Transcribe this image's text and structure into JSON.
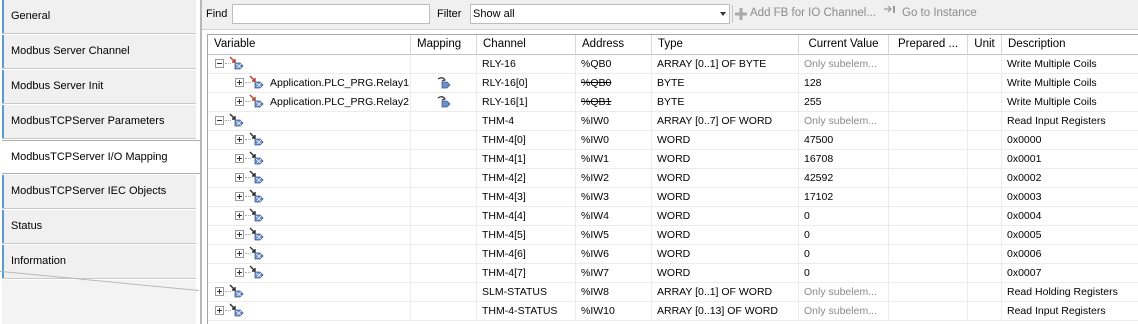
{
  "sidebar": {
    "tabs": [
      {
        "label": "General",
        "active": false
      },
      {
        "label": "Modbus Server Channel",
        "active": false
      },
      {
        "label": "Modbus Server Init",
        "active": false
      },
      {
        "label": "ModbusTCPServer Parameters",
        "active": false
      },
      {
        "label": "ModbusTCPServer I/O Mapping",
        "active": true
      },
      {
        "label": "ModbusTCPServer IEC Objects",
        "active": false
      },
      {
        "label": "Status",
        "active": false
      },
      {
        "label": "Information",
        "active": false
      }
    ]
  },
  "toolbar": {
    "find_label": "Find",
    "find_value": "",
    "filter_label": "Filter",
    "filter_value": "Show all",
    "add_fb_label": "Add FB for IO Channel...",
    "goto_label": "Go to Instance"
  },
  "table": {
    "columns": [
      "Variable",
      "Mapping",
      "Channel",
      "Address",
      "Type",
      "Current Value",
      "Prepared ...",
      "Unit",
      "Description"
    ],
    "rows": [
      {
        "level": 0,
        "expander": "minus",
        "variable": "",
        "mapping": false,
        "channel": "RLY-16",
        "address": "%QB0",
        "address_strike": false,
        "type": "ARRAY [0..1] OF BYTE",
        "current_value": "Only subelem...",
        "value_gray": true,
        "description": "Write Multiple Coils",
        "icon": "output"
      },
      {
        "level": 1,
        "expander": "plus",
        "variable": "Application.PLC_PRG.Relay1",
        "mapping": true,
        "channel": "RLY-16[0]",
        "address": "%QB0",
        "address_strike": true,
        "type": "BYTE",
        "current_value": "128",
        "value_gray": false,
        "description": "Write Multiple Coils",
        "icon": "output"
      },
      {
        "level": 1,
        "expander": "plus",
        "variable": "Application.PLC_PRG.Relay2",
        "mapping": true,
        "channel": "RLY-16[1]",
        "address": "%QB1",
        "address_strike": true,
        "type": "BYTE",
        "current_value": "255",
        "value_gray": false,
        "description": "Write Multiple Coils",
        "icon": "output"
      },
      {
        "level": 0,
        "expander": "minus",
        "variable": "",
        "mapping": false,
        "channel": "THM-4",
        "address": "%IW0",
        "address_strike": false,
        "type": "ARRAY [0..7] OF WORD",
        "current_value": "Only subelem...",
        "value_gray": true,
        "description": "Read Input Registers",
        "icon": "input"
      },
      {
        "level": 1,
        "expander": "plus",
        "variable": "",
        "mapping": false,
        "channel": "THM-4[0]",
        "address": "%IW0",
        "address_strike": false,
        "type": "WORD",
        "current_value": "47500",
        "value_gray": false,
        "description": "0x0000",
        "icon": "input"
      },
      {
        "level": 1,
        "expander": "plus",
        "variable": "",
        "mapping": false,
        "channel": "THM-4[1]",
        "address": "%IW1",
        "address_strike": false,
        "type": "WORD",
        "current_value": "16708",
        "value_gray": false,
        "description": "0x0001",
        "icon": "input"
      },
      {
        "level": 1,
        "expander": "plus",
        "variable": "",
        "mapping": false,
        "channel": "THM-4[2]",
        "address": "%IW2",
        "address_strike": false,
        "type": "WORD",
        "current_value": "42592",
        "value_gray": false,
        "description": "0x0002",
        "icon": "input"
      },
      {
        "level": 1,
        "expander": "plus",
        "variable": "",
        "mapping": false,
        "channel": "THM-4[3]",
        "address": "%IW3",
        "address_strike": false,
        "type": "WORD",
        "current_value": "17102",
        "value_gray": false,
        "description": "0x0003",
        "icon": "input"
      },
      {
        "level": 1,
        "expander": "plus",
        "variable": "",
        "mapping": false,
        "channel": "THM-4[4]",
        "address": "%IW4",
        "address_strike": false,
        "type": "WORD",
        "current_value": "0",
        "value_gray": false,
        "description": "0x0004",
        "icon": "input"
      },
      {
        "level": 1,
        "expander": "plus",
        "variable": "",
        "mapping": false,
        "channel": "THM-4[5]",
        "address": "%IW5",
        "address_strike": false,
        "type": "WORD",
        "current_value": "0",
        "value_gray": false,
        "description": "0x0005",
        "icon": "input"
      },
      {
        "level": 1,
        "expander": "plus",
        "variable": "",
        "mapping": false,
        "channel": "THM-4[6]",
        "address": "%IW6",
        "address_strike": false,
        "type": "WORD",
        "current_value": "0",
        "value_gray": false,
        "description": "0x0006",
        "icon": "input"
      },
      {
        "level": 1,
        "expander": "plus",
        "variable": "",
        "mapping": false,
        "channel": "THM-4[7]",
        "address": "%IW7",
        "address_strike": false,
        "type": "WORD",
        "current_value": "0",
        "value_gray": false,
        "description": "0x0007",
        "icon": "input"
      },
      {
        "level": 0,
        "expander": "plus",
        "variable": "",
        "mapping": false,
        "channel": "SLM-STATUS",
        "address": "%IW8",
        "address_strike": false,
        "type": "ARRAY [0..1] OF WORD",
        "current_value": "Only subelem...",
        "value_gray": true,
        "description": "Read Holding Registers",
        "icon": "input"
      },
      {
        "level": 0,
        "expander": "plus",
        "variable": "",
        "mapping": false,
        "channel": "THM-4-STATUS",
        "address": "%IW10",
        "address_strike": false,
        "type": "ARRAY [0..13] OF WORD",
        "current_value": "Only subelem...",
        "value_gray": true,
        "description": "Read Input Registers",
        "icon": "input"
      }
    ]
  },
  "colors": {
    "tab_accent": "#5b9bd5",
    "io_output_arrow": "#c0392b",
    "io_input_arrow": "#2c2c2c",
    "io_body": "#6b8fc9"
  }
}
